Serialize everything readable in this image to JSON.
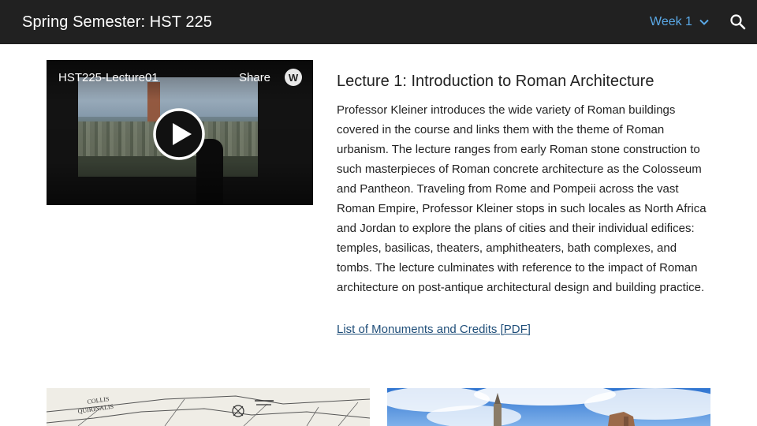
{
  "header": {
    "site_title": "Spring Semester: HST 225",
    "week_label": "Week 1",
    "week_icon": "chevron-down-icon",
    "search_icon": "search-icon",
    "accent_color": "#5aa8e6",
    "bar_color": "#212121"
  },
  "video": {
    "title": "HST225-Lecture01",
    "share_label": "Share",
    "logo_letter": "W",
    "play_icon": "play-icon"
  },
  "lecture": {
    "title": "Lecture 1: Introduction to Roman Architecture",
    "description": "Professor Kleiner introduces the wide variety of Roman buildings covered in the course and links them with the theme of Roman urbanism. The lecture ranges from early Roman stone construction to such masterpieces of Roman concrete architecture as the Colosseum and Pantheon. Traveling from Rome and Pompeii across the vast Roman Empire, Professor Kleiner stops in such locales as North Africa and Jordan to explore the plans of cities and their individual edifices: temples, basilicas, theaters, amphitheaters, bath complexes, and tombs. The lecture culminates with reference to the impact of Roman architecture on post-antique architectural design and building practice.",
    "pdf_link_label": "List of Monuments and Credits [PDF]"
  },
  "map_image": {
    "labels": [
      "COLLIS",
      "QUIRINALIS"
    ]
  }
}
